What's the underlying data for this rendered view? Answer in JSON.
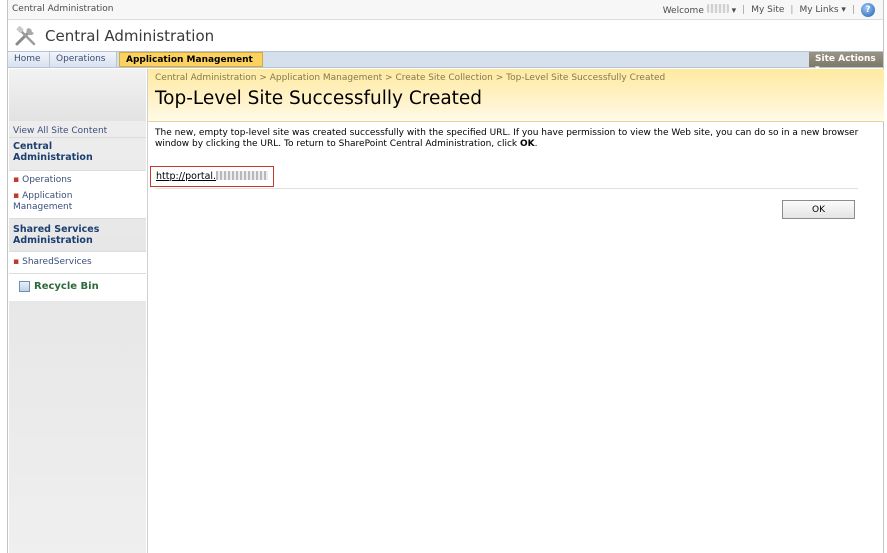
{
  "global_bar": {
    "app_title": "Central Administration",
    "welcome": "Welcome",
    "user_caret": "▾",
    "my_site": "My Site",
    "my_links": "My Links",
    "my_links_caret": "▾",
    "separator": "|",
    "help_glyph": "?"
  },
  "title_area": {
    "site_title": "Central Administration"
  },
  "tabs": [
    {
      "label": "Home"
    },
    {
      "label": "Operations"
    },
    {
      "label": "Application Management"
    }
  ],
  "site_actions": {
    "label": "Site Actions",
    "caret": "▾"
  },
  "left_nav": {
    "view_all": "View All Site Content",
    "sections": [
      {
        "heading": "Central Administration",
        "items": [
          "Operations",
          "Application Management"
        ]
      },
      {
        "heading": "Shared Services Administration",
        "items": [
          "SharedServices"
        ]
      }
    ],
    "recycle_bin": "Recycle Bin",
    "bullet": "▪"
  },
  "main": {
    "breadcrumb": "Central Administration > Application Management > Create Site Collection > Top-Level Site Successfully Created",
    "title": "Top-Level Site Successfully Created",
    "description_line1": "The new, empty top-level site was created successfully with the specified URL. If you have permission to view the Web site, you can do so in a new browser",
    "description_line2_pre": "window by clicking the URL.  To return to SharePoint Central Administration, click ",
    "description_line2_bold": "OK",
    "description_line2_post": ".",
    "url_text": "http://portal.",
    "ok_label": "OK"
  },
  "colors": {
    "tab_active": "#fbd25f",
    "site_actions_bg": "#8a8474",
    "page_head_bg": "#ffeaa0",
    "nav_heading": "#1c3f70",
    "url_highlight": "#c0392b"
  }
}
